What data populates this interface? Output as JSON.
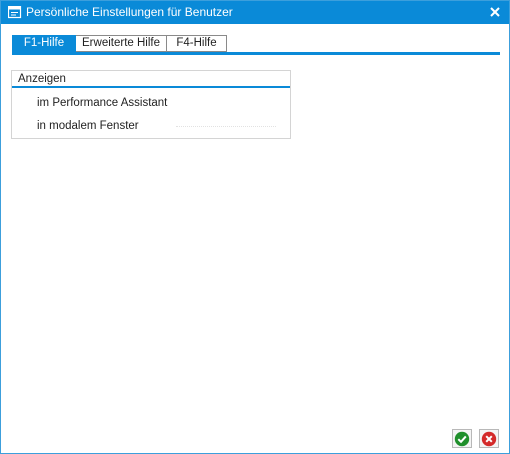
{
  "window": {
    "title": "Persönliche Einstellungen für Benutzer"
  },
  "tabs": [
    {
      "label": "F1-Hilfe",
      "active": true
    },
    {
      "label": "Erweiterte Hilfe",
      "active": false
    },
    {
      "label": "F4-Hilfe",
      "active": false
    }
  ],
  "group": {
    "title": "Anzeigen",
    "options": [
      {
        "label": "im Performance Assistant"
      },
      {
        "label": "in modalem Fenster"
      }
    ]
  },
  "footer": {
    "ok_icon": "checkmark-icon",
    "cancel_icon": "cancel-icon"
  },
  "colors": {
    "accent": "#0a8ad8",
    "ok": "#1f8f2b",
    "cancel": "#d42a2a"
  }
}
